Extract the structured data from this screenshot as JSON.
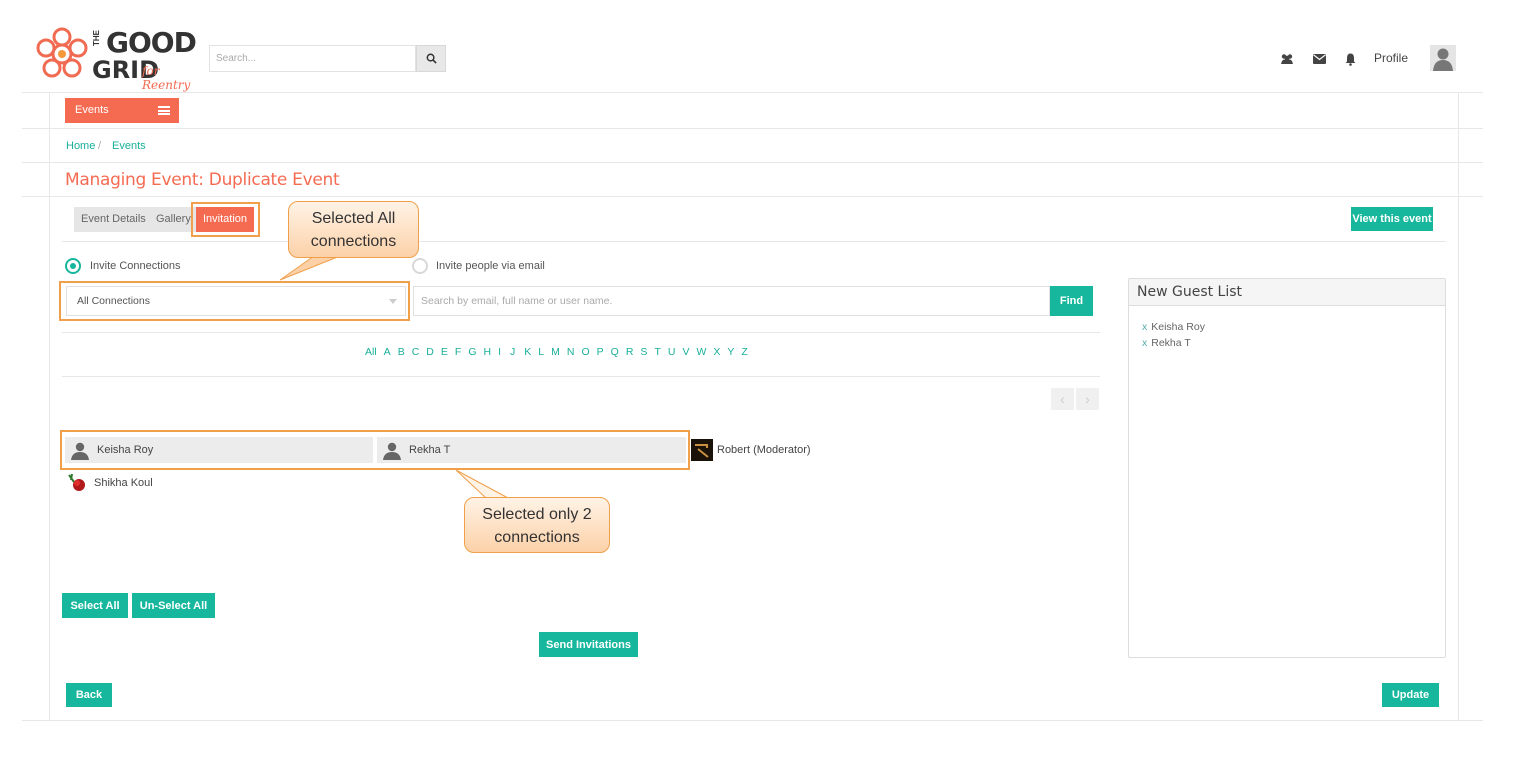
{
  "header": {
    "logo": {
      "line1": "GOOD",
      "the": "THE",
      "line2": "GRID",
      "tagline": "for Reentry"
    },
    "search_placeholder": "Search...",
    "profile_label": "Profile",
    "icons": [
      "users-icon",
      "envelope-icon",
      "bell-icon"
    ]
  },
  "nav": {
    "events_label": "Events"
  },
  "breadcrumb": {
    "home": "Home",
    "sep": "/",
    "current": "Events"
  },
  "page_title": "Managing Event: Duplicate Event",
  "tabs": [
    {
      "label": "Event Details",
      "active": false
    },
    {
      "label": "Gallery",
      "active": false
    },
    {
      "label": "Invitation",
      "active": true
    }
  ],
  "view_event_label": "View this event",
  "invite_options": {
    "connections": "Invite Connections",
    "email": "Invite people via email"
  },
  "filter": {
    "selected": "All Connections",
    "search_placeholder": "Search by email, full name or user name.",
    "find_label": "Find"
  },
  "alphabet": [
    "All",
    "A",
    "B",
    "C",
    "D",
    "E",
    "F",
    "G",
    "H",
    "I",
    "J",
    "K",
    "L",
    "M",
    "N",
    "O",
    "P",
    "Q",
    "R",
    "S",
    "T",
    "U",
    "V",
    "W",
    "X",
    "Y",
    "Z"
  ],
  "connections": [
    {
      "name": "Keisha Roy",
      "selected": true
    },
    {
      "name": "Rekha T",
      "selected": true
    },
    {
      "name": "Robert (Moderator)",
      "selected": false
    },
    {
      "name": "Shikha Koul",
      "selected": false
    }
  ],
  "actions": {
    "select_all": "Select All",
    "unselect_all": "Un-Select All",
    "send": "Send Invitations",
    "back": "Back",
    "update": "Update"
  },
  "guest_list": {
    "title": "New Guest List",
    "remove_symbol": "x",
    "items": [
      "Keisha Roy",
      "Rekha T"
    ]
  },
  "annotations": {
    "callout_top": "Selected All connections",
    "callout_bottom": "Selected only 2 connections"
  },
  "colors": {
    "accent": "#f56b52",
    "teal": "#17b79d",
    "highlight": "#f0a04a"
  }
}
